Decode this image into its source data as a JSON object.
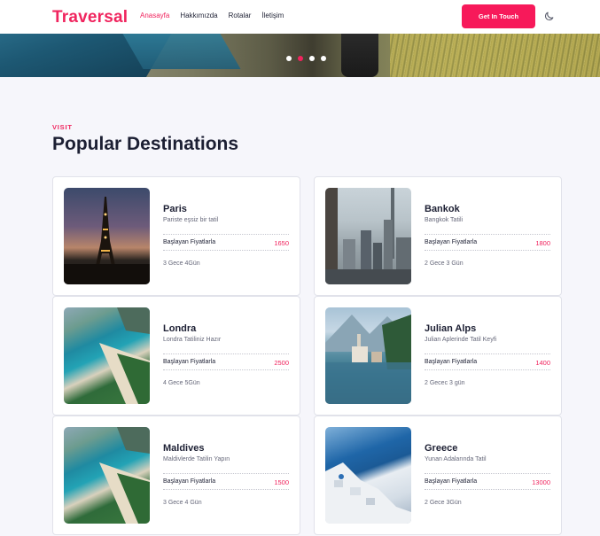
{
  "brand": "Traversal",
  "nav": {
    "links": [
      "Anasayfa",
      "Hakkımızda",
      "Rotalar",
      "İletişim"
    ],
    "cta": "Get In Touch"
  },
  "section": {
    "kicker": "VISIT",
    "title": "Popular Destinations"
  },
  "cards": [
    {
      "title": "Paris",
      "subtitle": "Pariste eşsiz bir tatil",
      "price_label": "Başlayan Fiyatlarla",
      "price": "1650",
      "duration": "3 Gece 4Gün"
    },
    {
      "title": "Bankok",
      "subtitle": "Bangkok Tatili",
      "price_label": "Başlayan Fiyatlarla",
      "price": "1800",
      "duration": "2 Gece 3 Gün"
    },
    {
      "title": "Londra",
      "subtitle": "Londra Tatiliniz Hazır",
      "price_label": "Başlayan Fiyatlarla",
      "price": "2500",
      "duration": "4 Gece 5Gün"
    },
    {
      "title": "Julian Alps",
      "subtitle": "Julian Aplerinde Tatil Keyfi",
      "price_label": "Başlayan Fiyatlarla",
      "price": "1400",
      "duration": "2 Gecec 3 gün"
    },
    {
      "title": "Maldives",
      "subtitle": "Maldivlerde Tatilin Yapın",
      "price_label": "Başlayan Fiyatlarla",
      "price": "1500",
      "duration": "3 Gece 4 Gün"
    },
    {
      "title": "Greece",
      "subtitle": "Yunan Adalarında Tatil",
      "price_label": "Başlayan Fiyatlarla",
      "price": "13000",
      "duration": "2 Gece 3Gün"
    }
  ],
  "colors": {
    "accent": "#f0245e",
    "background": "#f6f6fb",
    "text": "#1f2235"
  },
  "icons": {
    "theme_toggle": "moon-icon",
    "carousel": "carousel-dot"
  },
  "carousel": {
    "slides": 4,
    "active": 2
  }
}
